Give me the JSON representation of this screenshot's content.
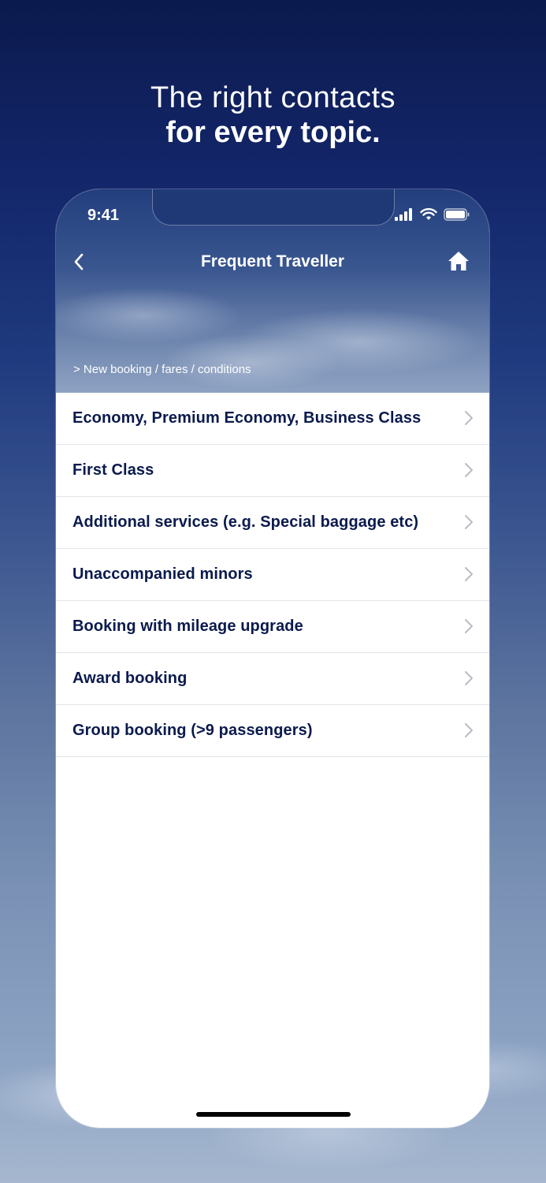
{
  "headline": {
    "line1": "The right contacts",
    "line2": "for every topic."
  },
  "status_bar": {
    "time": "9:41",
    "icons": [
      "signal-icon",
      "wifi-icon",
      "battery-icon"
    ]
  },
  "nav": {
    "title": "Frequent Traveller",
    "back_icon": "chevron-left-icon",
    "home_icon": "home-icon"
  },
  "breadcrumb": "> New booking / fares / conditions",
  "menu": {
    "items": [
      {
        "label": "Economy, Premium Economy, Business Class"
      },
      {
        "label": "First Class"
      },
      {
        "label": "Additional services (e.g. Special baggage etc)"
      },
      {
        "label": "Unaccompanied minors"
      },
      {
        "label": "Booking with mileage upgrade"
      },
      {
        "label": "Award booking"
      },
      {
        "label": "Group booking (>9 passengers)"
      }
    ]
  },
  "colors": {
    "brand_navy": "#0b1a4d",
    "divider": "#e2e4ea",
    "chevron": "#b8bcc6"
  }
}
